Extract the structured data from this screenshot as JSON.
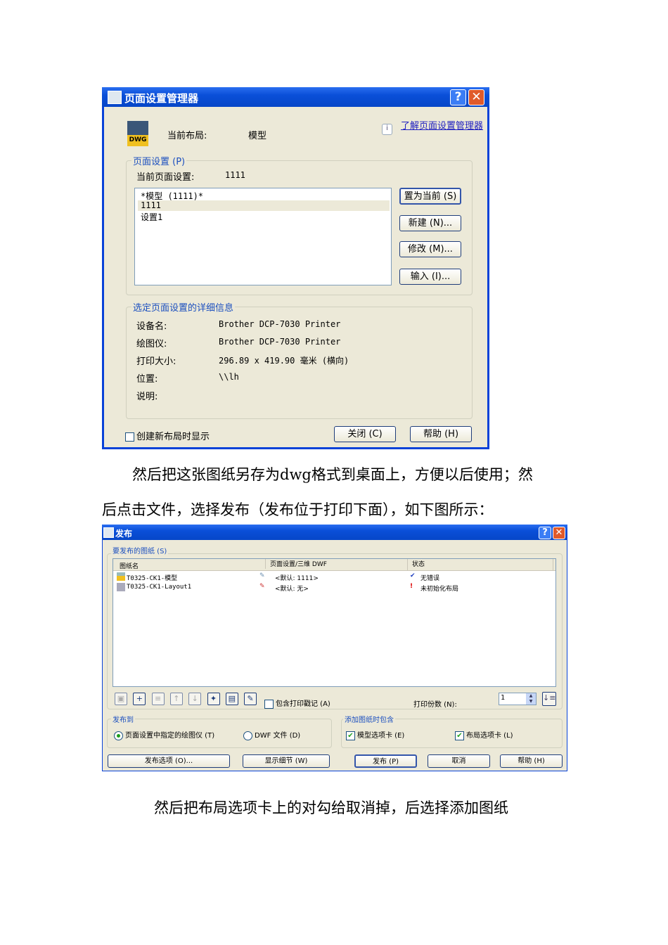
{
  "dialog1": {
    "title": "页面设置管理器",
    "current_layout_label": "当前布局:",
    "current_layout_value": "模型",
    "help_link": "了解页面设置管理器",
    "page_setup_group": "页面设置 (P)",
    "current_setup_label": "当前页面设置:",
    "current_setup_value": "1111",
    "list_items": [
      "*模型 (1111)*",
      "1111",
      "设置1"
    ],
    "selected_index": 1,
    "buttons": {
      "set_current": "置为当前 (S)",
      "new": "新建 (N)...",
      "modify": "修改 (M)...",
      "import": "输入 (I)...",
      "close": "关闭 (C)",
      "help": "帮助 (H)"
    },
    "details_group": "选定页面设置的详细信息",
    "details": [
      {
        "label": "设备名:",
        "value": "Brother DCP-7030 Printer"
      },
      {
        "label": "绘图仪:",
        "value": "Brother DCP-7030 Printer"
      },
      {
        "label": "打印大小:",
        "value": "296.89 x 419.90 毫米 (横向)"
      },
      {
        "label": "位置:",
        "value": "\\\\lh"
      },
      {
        "label": "说明:",
        "value": ""
      }
    ],
    "show_on_new_layout": "创建新布局时显示",
    "show_on_new_layout_checked": false
  },
  "paragraph1_line1": "然后把这张图纸另存为dwg格式到桌面上，方便以后使用；然",
  "paragraph1_line2": "后点击文件，选择发布（发布位于打印下面），如下图所示：",
  "dialog2": {
    "title": "发布",
    "sheets_group": "要发布的图纸 (S)",
    "columns": [
      "图纸名",
      "页面设置/三维 DWF",
      "状态"
    ],
    "rows": [
      {
        "name": "T0325-CK1-模型",
        "setup": "<默认: 1111>",
        "status": "无错误",
        "status_icon": "check-icon"
      },
      {
        "name": "T0325-CK1-Layout1",
        "setup": "<默认: 无>",
        "status": "未初始化布局",
        "status_icon": "warning-icon"
      }
    ],
    "include_stamp": "包含打印戳记 (A)",
    "include_stamp_checked": false,
    "copies_label": "打印份数 (N):",
    "copies_value": "1",
    "publish_to_group": "发布到",
    "radio_plotter": "页面设置中指定的绘图仪 (T)",
    "radio_dwf": "DWF 文件 (D)",
    "radio_selected": "plotter",
    "include_group": "添加图纸时包含",
    "model_tab": "模型选项卡 (E)",
    "model_tab_checked": true,
    "layout_tab": "布局选项卡 (L)",
    "layout_tab_checked": true,
    "buttons": {
      "options": "发布选项 (O)...",
      "details": "显示细节 (W)",
      "publish": "发布 (P)",
      "cancel": "取消",
      "help": "帮助 (H)"
    }
  },
  "paragraph2": "然后把布局选项卡上的对勾给取消掉，后选择添加图纸"
}
